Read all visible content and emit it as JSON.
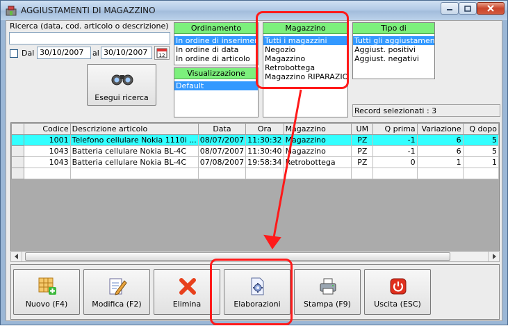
{
  "window": {
    "title": "AGGIUSTAMENTI DI MAGAZZINO"
  },
  "search": {
    "label": "Ricerca (data, cod. articolo o descrizione)",
    "value": "",
    "dal_label": "Dal",
    "date_from": "30/10/2007",
    "al_label": "al",
    "date_to": "30/10/2007",
    "calendar_day": "12",
    "run_button": "Esegui ricerca"
  },
  "ordinamento": {
    "header": "Ordinamento",
    "items": [
      "In ordine di inserimento",
      "In ordine di data",
      "In ordine di articolo"
    ]
  },
  "visualizzazione": {
    "header": "Visualizzazione",
    "items": [
      "Default"
    ]
  },
  "magazzino": {
    "header": "Magazzino",
    "items": [
      "Tutti i magazzini",
      "Negozio",
      "Magazzino",
      "Retrobottega",
      "Magazzino RIPARAZIONI"
    ]
  },
  "tipo": {
    "header": "Tipo di aggiustamento",
    "items": [
      "Tutti gli aggiustamenti",
      "Aggiust. positivi",
      "Aggiust. negativi"
    ]
  },
  "record_status": "Record selezionati : 3",
  "grid": {
    "columns": [
      "Codice",
      "Descrizione articolo",
      "Data",
      "Ora",
      "Magazzino",
      "UM",
      "Q prima",
      "Variazione",
      "Q dopo"
    ],
    "rows": [
      [
        "1001",
        "Telefono cellulare Nokia 1110i ...",
        "08/07/2007",
        "11:30:32",
        "Magazzino",
        "PZ",
        "-1",
        "6",
        "5"
      ],
      [
        "1043",
        "Batteria cellulare Nokia BL-4C",
        "08/07/2007",
        "11:30:40",
        "Magazzino",
        "PZ",
        "-1",
        "6",
        "5"
      ],
      [
        "1043",
        "Batteria cellulare Nokia BL-4C",
        "07/08/2007",
        "19:58:34",
        "Retrobottega",
        "PZ",
        "0",
        "1",
        "1"
      ]
    ]
  },
  "toolbar": {
    "nuovo": "Nuovo (F4)",
    "modifica": "Modifica (F2)",
    "elimina": "Elimina",
    "elaborazioni": "Elaborazioni",
    "stampa": "Stampa (F9)",
    "uscita": "Uscita (ESC)"
  },
  "colors": {
    "panel_header": "#7cf07c",
    "selection": "#3399ff",
    "row_highlight": "#33ffff",
    "annotation": "#ff1a1a"
  }
}
